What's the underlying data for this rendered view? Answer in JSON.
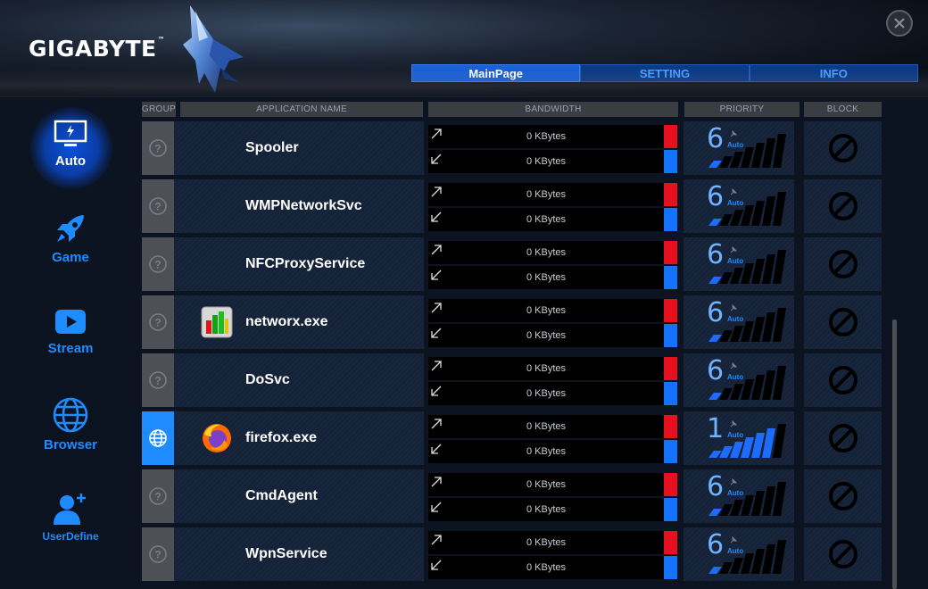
{
  "header": {
    "brand": "GIGABYTE",
    "brand_mark": "™",
    "tabs": [
      {
        "label": "MainPage",
        "active": true
      },
      {
        "label": "SETTING",
        "active": false
      },
      {
        "label": "INFO",
        "active": false
      }
    ]
  },
  "sidebar": {
    "items": [
      {
        "label": "Auto",
        "icon": "monitor-icon",
        "active": true
      },
      {
        "label": "Game",
        "icon": "rocket-icon",
        "active": false
      },
      {
        "label": "Stream",
        "icon": "play-icon",
        "active": false
      },
      {
        "label": "Browser",
        "icon": "globe-icon",
        "active": false
      },
      {
        "label": "UserDefine",
        "icon": "user-add-icon",
        "active": false
      }
    ]
  },
  "table": {
    "columns": [
      "GROUP",
      "APPLICATION NAME",
      "BANDWIDTH",
      "PRIORITY",
      "BLOCK"
    ],
    "rows": [
      {
        "name": "Spooler",
        "group": "unknown",
        "icon": "",
        "up": "0 KBytes",
        "down": "0 KBytes",
        "priority": "6",
        "priority_mode": "Auto",
        "priority_level": 1
      },
      {
        "name": "WMPNetworkSvc",
        "group": "unknown",
        "icon": "",
        "up": "0 KBytes",
        "down": "0 KBytes",
        "priority": "6",
        "priority_mode": "Auto",
        "priority_level": 1
      },
      {
        "name": "NFCProxyService",
        "group": "unknown",
        "icon": "",
        "up": "0 KBytes",
        "down": "0 KBytes",
        "priority": "6",
        "priority_mode": "Auto",
        "priority_level": 1
      },
      {
        "name": "networx.exe",
        "group": "unknown",
        "icon": "networx-icon",
        "up": "0 KBytes",
        "down": "0 KBytes",
        "priority": "6",
        "priority_mode": "Auto",
        "priority_level": 1
      },
      {
        "name": "DoSvc",
        "group": "unknown",
        "icon": "",
        "up": "0 KBytes",
        "down": "0 KBytes",
        "priority": "6",
        "priority_mode": "Auto",
        "priority_level": 1
      },
      {
        "name": "firefox.exe",
        "group": "browser",
        "icon": "firefox-icon",
        "up": "0 KBytes",
        "down": "0 KBytes",
        "priority": "1",
        "priority_mode": "Auto",
        "priority_level": 6
      },
      {
        "name": "CmdAgent",
        "group": "unknown",
        "icon": "",
        "up": "0 KBytes",
        "down": "0 KBytes",
        "priority": "6",
        "priority_mode": "Auto",
        "priority_level": 1
      },
      {
        "name": "WpnService",
        "group": "unknown",
        "icon": "",
        "up": "0 KBytes",
        "down": "0 KBytes",
        "priority": "6",
        "priority_mode": "Auto",
        "priority_level": 1
      }
    ]
  },
  "colors": {
    "accent": "#1e8cff",
    "upload_bar": "#e8101e",
    "download_bar": "#1273ff",
    "active_tab": "#1a60d6"
  }
}
